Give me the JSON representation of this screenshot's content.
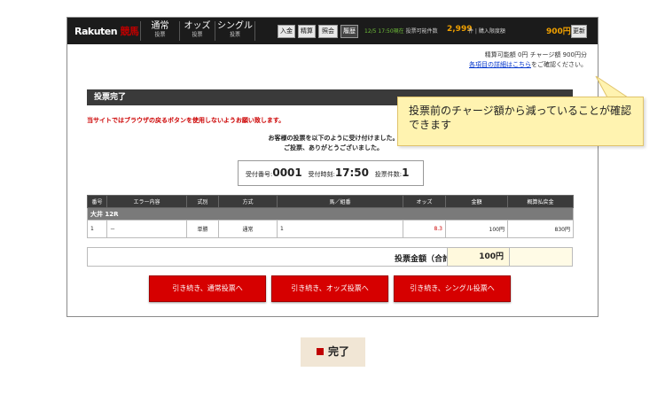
{
  "topbar": {
    "logo_brand": "Rakuten",
    "logo_suffix": "競馬",
    "tabs": [
      {
        "label": "通常",
        "sub": "投票"
      },
      {
        "label": "オッズ",
        "sub": "投票"
      },
      {
        "label": "シングル",
        "sub": "投票"
      }
    ],
    "buttons": [
      "入金",
      "精算",
      "照会",
      "履歴"
    ],
    "time_text": "12/5 17:50現在",
    "votable_label": "投票可能件数",
    "votable_count": "2,999",
    "votable_unit": "件",
    "purchase_limit_label": "購入限度額",
    "purchase_limit": "900円",
    "refresh_label": "更新"
  },
  "info": {
    "line1": "精算可能額 0円 チャージ額 900円分",
    "line2_link": "各項目の詳細はこちら",
    "line2_suffix": "をご確認ください。"
  },
  "section_title": "投票完了",
  "warning": "当サイトではブラウザの戻るボタンを使用しないようお願い致します。",
  "message_line1": "お客様の投票を以下のように受け付けました。",
  "message_line2": "ご投票、ありがとうございました。",
  "receipt": {
    "number_label": "受付番号:",
    "number": "0001",
    "time_label": "受付時刻:",
    "time": "17:50",
    "count_label": "投票件数:",
    "count": "1"
  },
  "table": {
    "headers": [
      "番号",
      "エラー内容",
      "式別",
      "方式",
      "馬／組番",
      "オッズ",
      "金額",
      "概算払戻金"
    ],
    "race": "大井 12R",
    "row": {
      "no": "1",
      "error": "－",
      "type": "単勝",
      "method": "通常",
      "horse": "1",
      "odds": "8.3",
      "amount": "100円",
      "payout": "830円"
    }
  },
  "total": {
    "label": "投票金額（合計）",
    "amount": "100円"
  },
  "action_buttons": [
    "引き続き、通常投票へ",
    "引き続き、オッズ投票へ",
    "引き続き、シングル投票へ"
  ],
  "callout_text": "投票前のチャージ額から減っていることが確認できます",
  "done_label": "完了",
  "colors": {
    "accent_red": "#d60000",
    "callout_bg": "#fff3b0",
    "done_bg": "#f1e6d5",
    "header_dark": "#1b1b1b"
  }
}
